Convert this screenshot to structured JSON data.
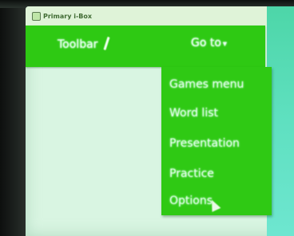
{
  "window": {
    "title": "Primary i-Box"
  },
  "toolbar": {
    "toolbar_label": "Toolbar",
    "goto_label": "Go to",
    "goto_caret": "▾"
  },
  "menu": {
    "items": [
      {
        "label": "Games menu"
      },
      {
        "label": "Word list"
      },
      {
        "label": "Presentation"
      },
      {
        "label": "Practice"
      },
      {
        "label": "Options"
      }
    ]
  },
  "colors": {
    "toolbar_green": "#2ec913",
    "screen_bg": "#d9f5e2",
    "text": "#e8fff0"
  },
  "icons": {
    "tool": "pencil-icon",
    "pointer": "hand-cursor-icon"
  }
}
